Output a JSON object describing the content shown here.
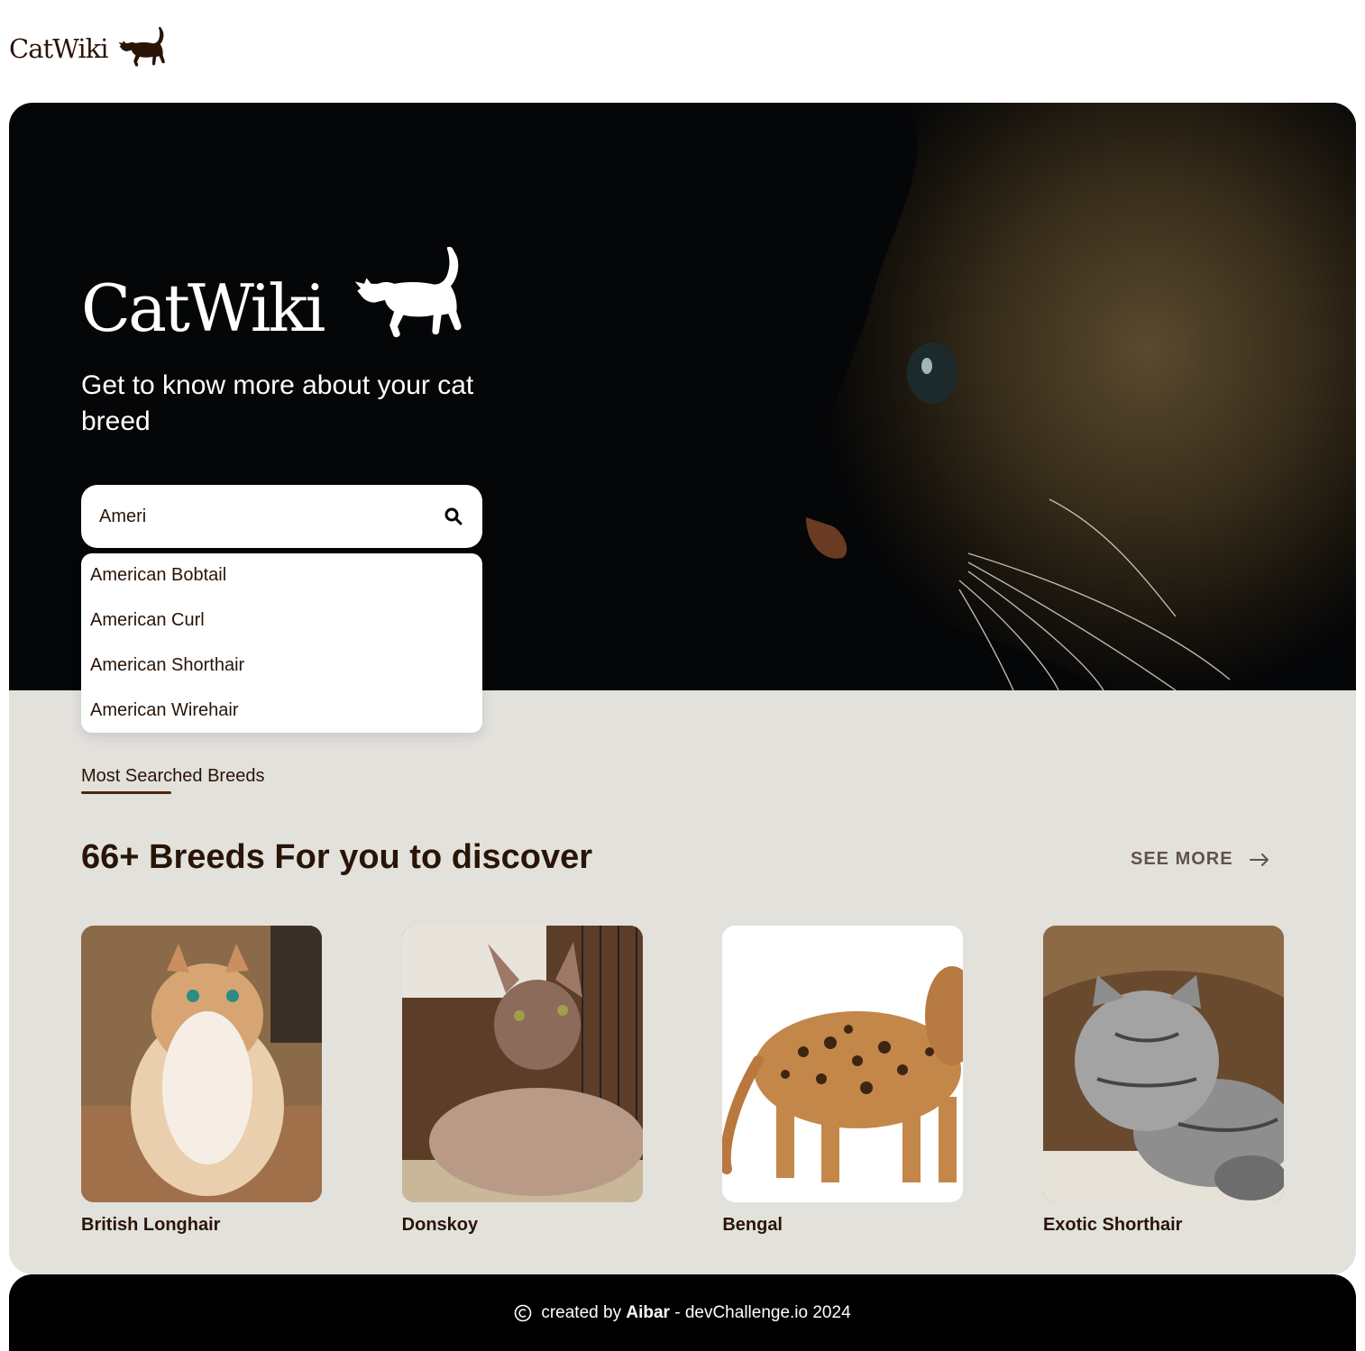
{
  "header": {
    "logo_text": "CatWiki"
  },
  "hero": {
    "logo_text": "CatWiki",
    "subtitle": "Get to know more about your cat breed",
    "search": {
      "value": "Ameri"
    },
    "suggestions": [
      "American Bobtail",
      "American Curl",
      "American Shorthair",
      "American Wirehair"
    ]
  },
  "breeds": {
    "label": "Most Searched Breeds",
    "heading": "66+ Breeds For you to discover",
    "see_more": "SEE MORE",
    "cards": [
      {
        "name": "British Longhair"
      },
      {
        "name": "Donskoy"
      },
      {
        "name": "Bengal"
      },
      {
        "name": "Exotic Shorthair"
      }
    ]
  },
  "footer": {
    "prefix": "created by",
    "author": "Aibar",
    "suffix": "- devChallenge.io 2024"
  },
  "colors": {
    "primary": "#291507",
    "accent": "#4d270c",
    "section_bg": "#e3e1dc"
  }
}
